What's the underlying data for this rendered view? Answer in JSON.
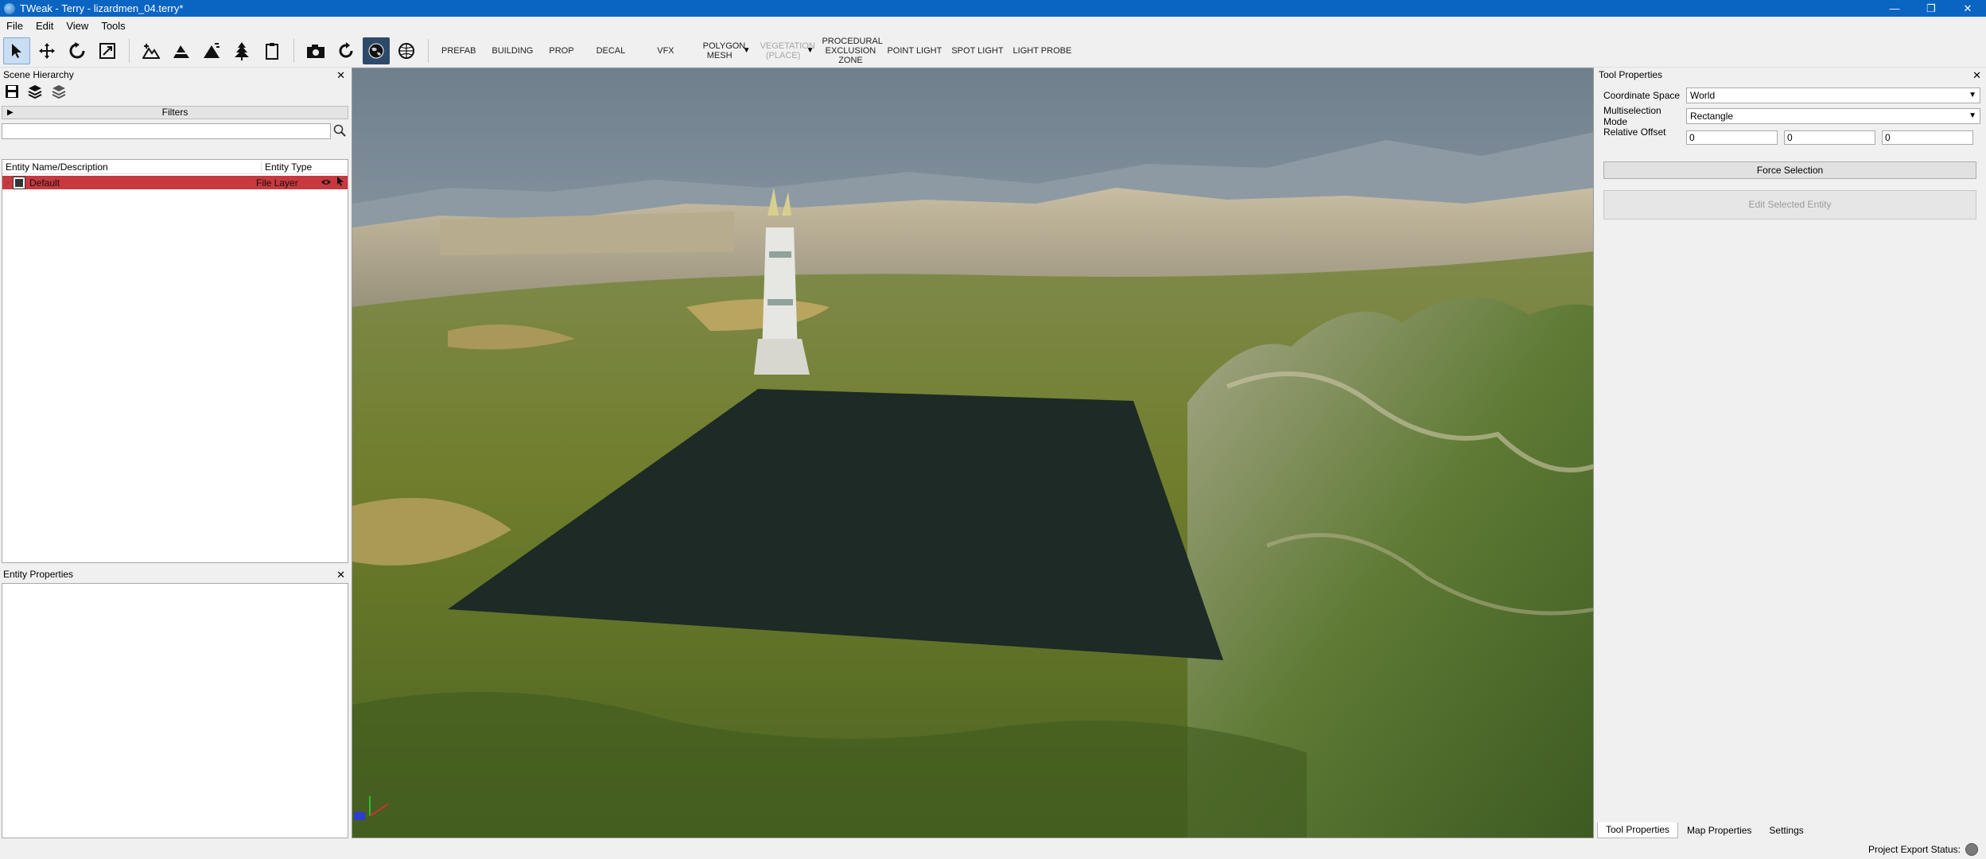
{
  "window": {
    "title": "TWeak - Terry - lizardmen_04.terry*",
    "minimize": "—",
    "maximize": "❐",
    "close": "✕"
  },
  "menu": [
    "File",
    "Edit",
    "View",
    "Tools"
  ],
  "toolbar": {
    "tools": [
      "select-arrow-icon",
      "move-icon",
      "rotate-icon",
      "scale-icon",
      "terrain-raise-icon",
      "terrain-flatten-icon",
      "terrain-smooth-icon",
      "tree-icon",
      "clipboard-icon",
      "camera-icon",
      "refresh-icon",
      "globe-icon",
      "sphere-icon"
    ],
    "categories": [
      {
        "label": "PREFAB"
      },
      {
        "label": "BUILDING"
      },
      {
        "label": "PROP"
      },
      {
        "label": "DECAL"
      },
      {
        "label": "VFX"
      },
      {
        "label": "POLYGON MESH"
      },
      {
        "label": "VEGETATION (PLACE)"
      },
      {
        "label": "PROCEDURAL EXCLUSION ZONE"
      },
      {
        "label": "POINT LIGHT"
      },
      {
        "label": "SPOT LIGHT"
      },
      {
        "label": "LIGHT PROBE"
      }
    ]
  },
  "scene_hierarchy": {
    "title": "Scene Hierarchy",
    "filters_label": "Filters",
    "search_placeholder": "",
    "columns": [
      "Entity Name/Description",
      "Entity Type"
    ],
    "rows": [
      {
        "name": "Default",
        "type": "File Layer"
      }
    ]
  },
  "entity_properties": {
    "title": "Entity Properties"
  },
  "tool_properties": {
    "title": "Tool Properties",
    "coordinate_space_label": "Coordinate Space",
    "coordinate_space_value": "World",
    "multiselection_label": "Multiselection Mode",
    "multiselection_value": "Rectangle",
    "relative_offset_label": "Relative Offset",
    "offset_x": "0",
    "offset_y": "0",
    "offset_z": "0",
    "force_selection": "Force Selection",
    "edit_selected": "Edit Selected Entity"
  },
  "tabs": [
    "Tool Properties",
    "Map Properties",
    "Settings"
  ],
  "status": {
    "project_export": "Project Export Status:"
  },
  "colors": {
    "titlebar": "#0a64c2",
    "selected_row": "#c8393f",
    "placeholder_plane": "#1d2a26"
  }
}
